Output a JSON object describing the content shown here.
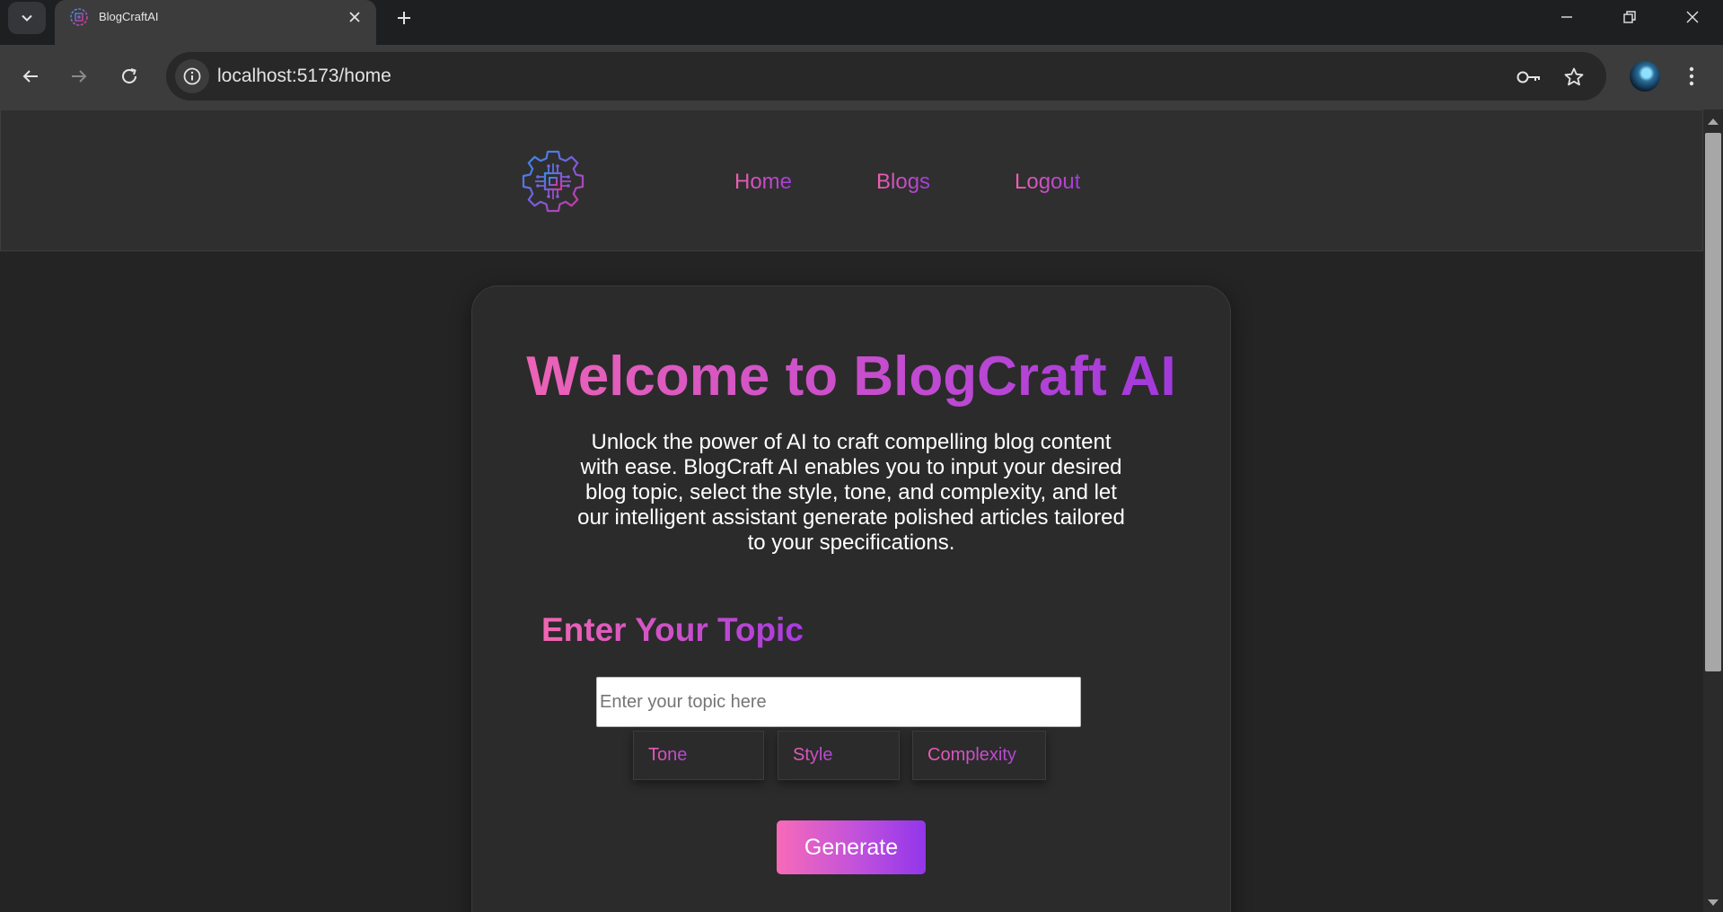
{
  "browser": {
    "tab_title": "BlogCraftAI",
    "url": "localhost:5173/home"
  },
  "navbar": {
    "links": [
      {
        "label": "Home"
      },
      {
        "label": "Blogs"
      },
      {
        "label": "Logout"
      }
    ]
  },
  "hero": {
    "title": "Welcome to BlogCraft AI",
    "description": "Unlock the power of AI to craft compelling blog content with ease. BlogCraft AI enables you to input your desired blog topic, select the style, tone, and complexity, and let our intelligent assistant generate polished articles tailored to your specifications."
  },
  "form": {
    "heading": "Enter Your Topic",
    "topic_placeholder": "Enter your topic here",
    "topic_value": "",
    "selects": {
      "tone": "Tone",
      "style": "Style",
      "complexity": "Complexity"
    },
    "generate_label": "Generate"
  },
  "colors": {
    "brand_pink": "#f266b2",
    "brand_purple": "#9b35df",
    "page_background": "#242424",
    "card_background": "#2b2b2b"
  },
  "icons": {
    "logo": "gear-chip-logo-icon",
    "site_info": "info-icon",
    "password": "key-icon",
    "bookmark": "star-icon"
  }
}
